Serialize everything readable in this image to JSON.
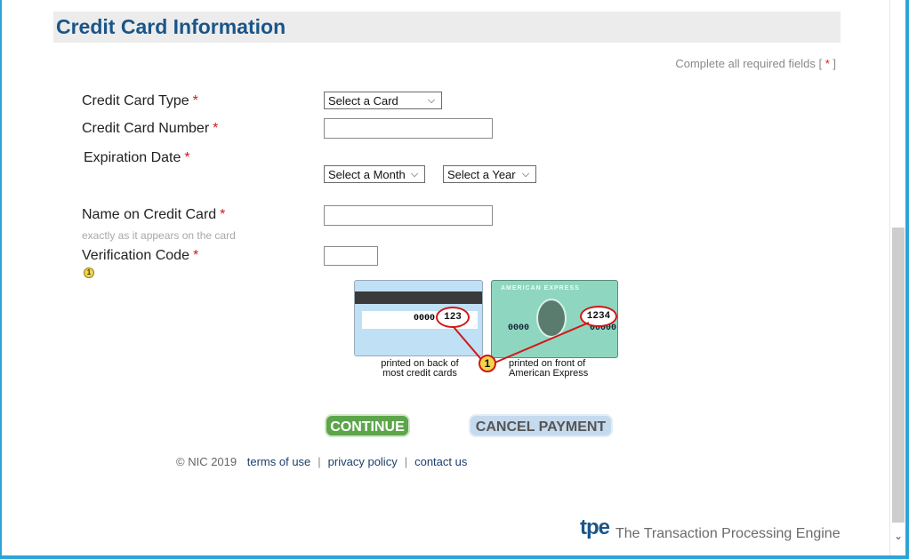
{
  "header": {
    "title": "Credit Card Information"
  },
  "required_note": {
    "prefix": "Complete all required fields [ ",
    "star": "*",
    "suffix": " ]"
  },
  "form": {
    "card_type": {
      "label": "Credit Card Type",
      "required": "*",
      "selected": "Select a Card"
    },
    "card_number": {
      "label": "Credit Card Number",
      "required": "*",
      "value": ""
    },
    "expiration": {
      "label": "Expiration Date",
      "required": "*",
      "month_selected": "Select a Month",
      "year_selected": "Select a Year"
    },
    "name": {
      "label": "Name on Credit Card",
      "required": "*",
      "hint": "exactly as it appears on the card",
      "value": ""
    },
    "verification": {
      "label": "Verification Code",
      "required": "*",
      "info_icon": "1",
      "value": ""
    }
  },
  "cvv_graphic": {
    "back_number": "0000",
    "back_code": "123",
    "front_brand": "AMERICAN EXPRESS",
    "front_number_left": "0000",
    "front_number_right": "00000",
    "front_code": "1234",
    "badge": "1",
    "caption_back_line1": "printed on back of",
    "caption_back_line2": "most credit cards",
    "caption_front_line1": "printed on front of",
    "caption_front_line2": "American Express"
  },
  "buttons": {
    "continue": "CONTINUE",
    "cancel": "CANCEL PAYMENT"
  },
  "footer": {
    "copyright": "© NIC 2019",
    "terms": "terms of use",
    "privacy": "privacy policy",
    "contact": "contact us",
    "separator": "|"
  },
  "branding": {
    "logo": "tpe",
    "tagline": "The Transaction Processing Engine"
  },
  "icons": {
    "scroll_down": "chevron-down-icon",
    "dropdown": "chevron-down-icon"
  }
}
